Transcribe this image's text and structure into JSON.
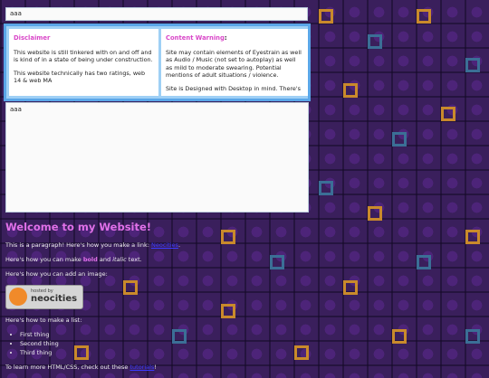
{
  "top_input": "aaa",
  "disclaimer": {
    "title": "Disclaimer",
    "p1": "This website is still tinkered with on and off and is kind of in a state of being under construction.",
    "p2": "This website technically has two ratings, web 14 & web MA"
  },
  "warning": {
    "title": "Content Warning",
    "colon": ":",
    "p1": "Site may contain elements of Eyestrain as well as Audio / Music (not set to autoplay) as well as mild to moderate swearing. Potential mentions of adult situations / violence.",
    "p2": "Site is Designed with Desktop in mind. There's"
  },
  "big_box_text": "aaa",
  "main": {
    "heading": "Welcome to my Website!",
    "para1_pre": "This is a paragraph! Here's how you make a link: ",
    "para1_link": "Neocities",
    "para1_post": ".",
    "para2_pre": "Here's how you can make ",
    "para2_bold": "bold",
    "para2_mid": " and ",
    "para2_italic": "italic",
    "para2_post": " text.",
    "para3": "Here's how you can add an image:",
    "badge_small": "hosted by",
    "badge_big": "neocities",
    "para4": "Here's how to make a list:",
    "list": [
      "First thing",
      "Second thing",
      "Third thing"
    ],
    "para5_pre": "To learn more HTML/CSS, check out these ",
    "para5_link": "tutorials",
    "para5_post": "!"
  },
  "colors": {
    "background": "#3a1f5c",
    "accent_pink": "#e070e8",
    "info_border": "#5aa6e8"
  }
}
